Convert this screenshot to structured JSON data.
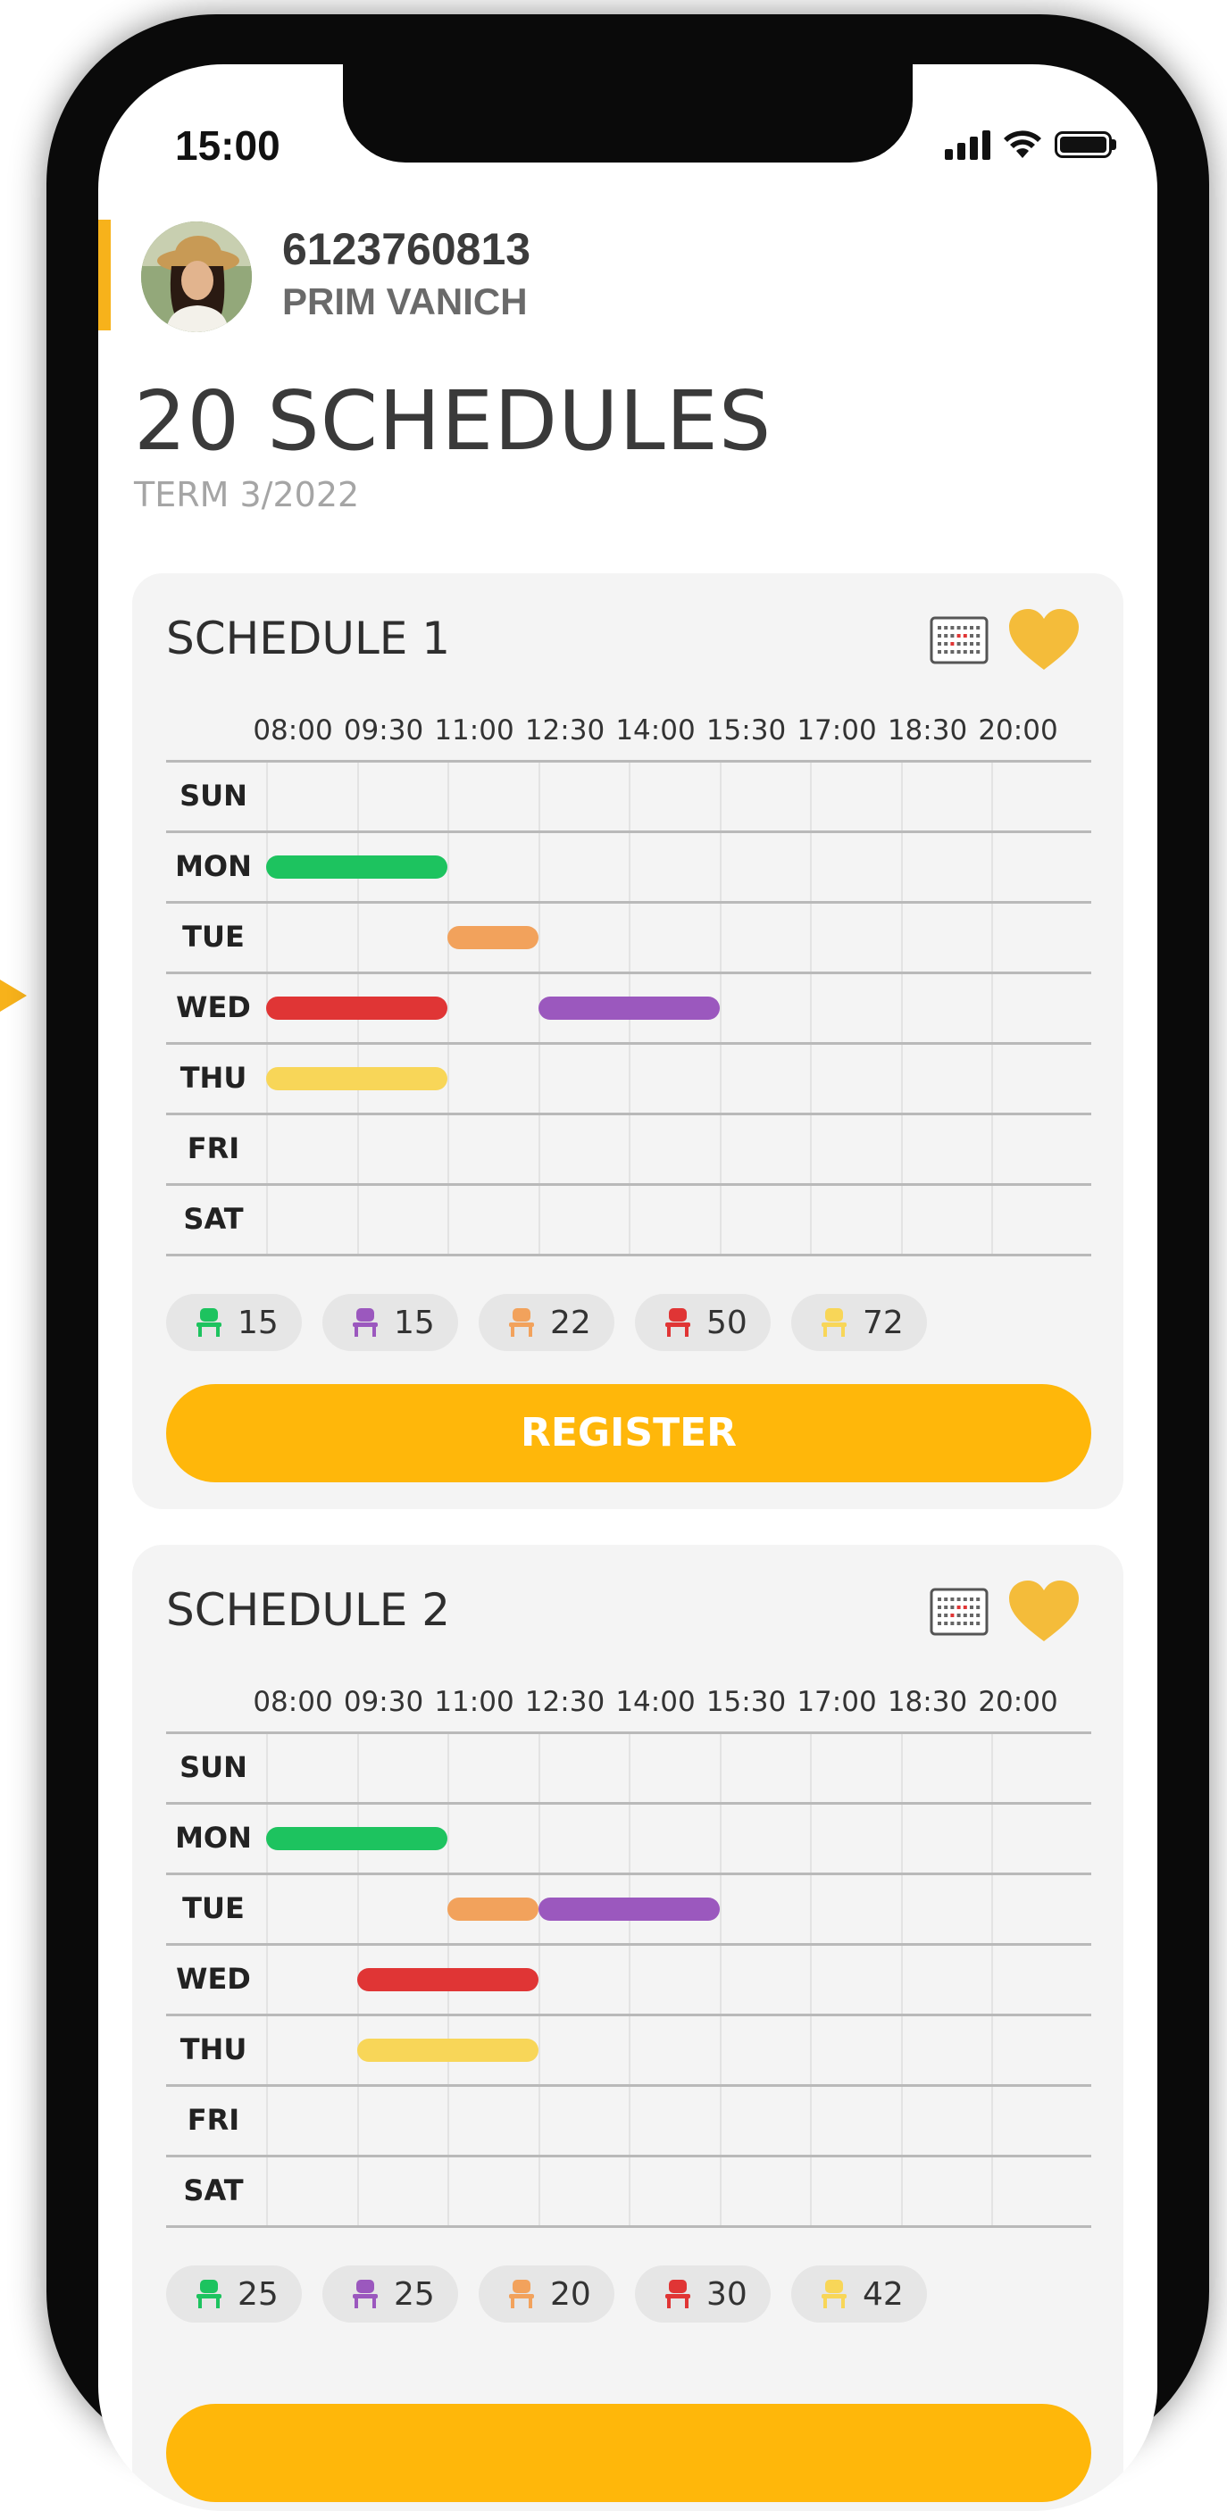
{
  "status_bar": {
    "time": "15:00"
  },
  "profile": {
    "id": "6123760813",
    "name": "PRIM VANICH"
  },
  "header": {
    "title": "20 SCHEDULES",
    "term": "TERM 3/2022"
  },
  "times": [
    "08:00",
    "09:30",
    "11:00",
    "12:30",
    "14:00",
    "15:30",
    "17:00",
    "18:30",
    "20:00"
  ],
  "days": [
    "SUN",
    "MON",
    "TUE",
    "WED",
    "THU",
    "FRI",
    "SAT"
  ],
  "colors": {
    "green": "#1DC35F",
    "orange": "#F2A25C",
    "red": "#E03535",
    "purple": "#9B58BE",
    "yellow": "#F8D658",
    "accent": "#FFB70A",
    "heart": "#F4BC3A"
  },
  "schedules": [
    {
      "title": "SCHEDULE 1",
      "register_label": "REGISTER",
      "blocks": [
        {
          "day": "MON",
          "start": "08:00",
          "end": "11:00",
          "color": "green"
        },
        {
          "day": "TUE",
          "start": "11:00",
          "end": "12:30",
          "color": "orange"
        },
        {
          "day": "WED",
          "start": "08:00",
          "end": "11:00",
          "color": "red"
        },
        {
          "day": "WED",
          "start": "12:30",
          "end": "15:30",
          "color": "purple"
        },
        {
          "day": "THU",
          "start": "08:00",
          "end": "11:00",
          "color": "yellow"
        }
      ],
      "seats": [
        {
          "color": "green",
          "count": "15"
        },
        {
          "color": "purple",
          "count": "15"
        },
        {
          "color": "orange",
          "count": "22"
        },
        {
          "color": "red",
          "count": "50"
        },
        {
          "color": "yellow",
          "count": "72"
        }
      ]
    },
    {
      "title": "SCHEDULE 2",
      "blocks": [
        {
          "day": "MON",
          "start": "08:00",
          "end": "11:00",
          "color": "green"
        },
        {
          "day": "TUE",
          "start": "11:00",
          "end": "12:30",
          "color": "orange"
        },
        {
          "day": "TUE",
          "start": "12:30",
          "end": "15:30",
          "color": "purple"
        },
        {
          "day": "WED",
          "start": "09:30",
          "end": "12:30",
          "color": "red"
        },
        {
          "day": "THU",
          "start": "09:30",
          "end": "12:30",
          "color": "yellow"
        }
      ],
      "seats": [
        {
          "color": "green",
          "count": "25"
        },
        {
          "color": "purple",
          "count": "25"
        },
        {
          "color": "orange",
          "count": "20"
        },
        {
          "color": "red",
          "count": "30"
        },
        {
          "color": "yellow",
          "count": "42"
        }
      ]
    }
  ]
}
